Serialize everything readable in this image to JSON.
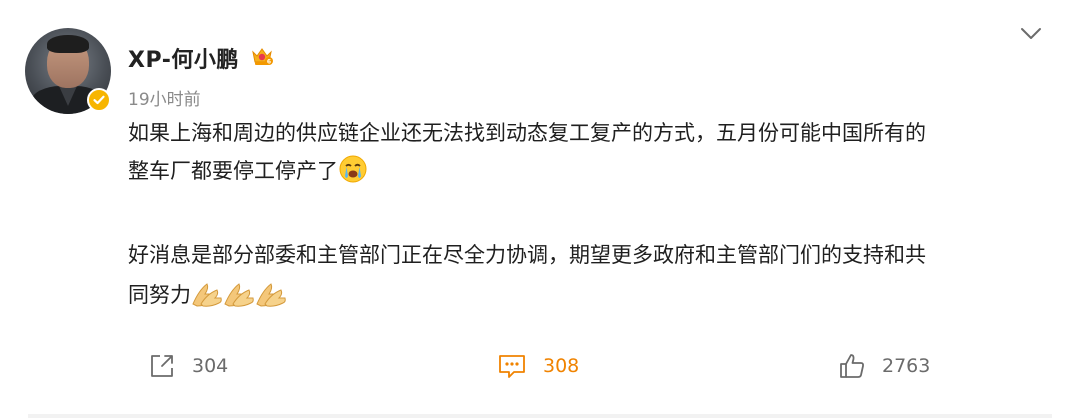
{
  "post": {
    "username": "XP-何小鹏",
    "timestamp": "19小时前",
    "text_line1": "如果上海和周边的供应链企业还无法找到动态复工复产的方式，五月份可能中国所有的",
    "text_line2": "整车厂都要停工停产了",
    "text_line3": "好消息是部分部委和主管部门正在尽全力协调，期望更多政府和主管部门们的支持和共",
    "text_line4": "同努力"
  },
  "actions": {
    "share_count": "304",
    "comment_count": "308",
    "like_count": "2763"
  },
  "icons": {
    "avatar": "avatar",
    "verified": "verified-badge-icon",
    "crown": "crown-badge-icon",
    "chevron": "chevron-down-icon",
    "crying": "crying-face-emoji",
    "pray": "pray-hands-emoji",
    "share": "share-icon",
    "comment": "comment-icon",
    "like": "thumbs-up-icon"
  },
  "colors": {
    "comment_accent": "#f08300",
    "verified": "#f7b500"
  }
}
